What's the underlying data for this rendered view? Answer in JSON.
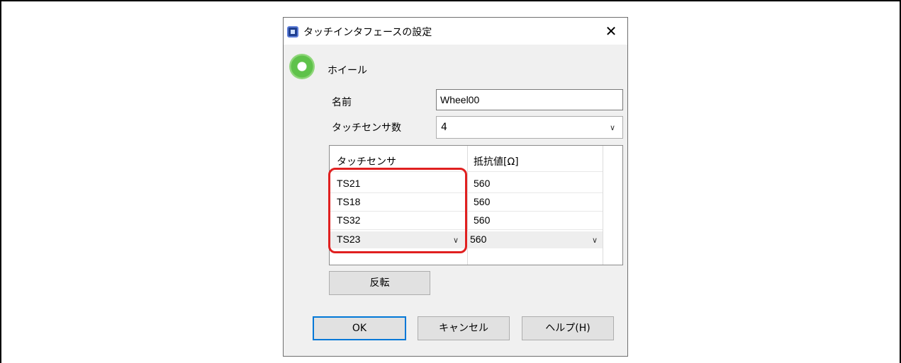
{
  "dialog": {
    "title": "タッチインタフェースの設定",
    "close_label": "✕",
    "section_title": "ホイール"
  },
  "form": {
    "name_label": "名前",
    "name_value": "Wheel00",
    "sensor_count_label": "タッチセンサ数",
    "sensor_count_value": "4"
  },
  "table": {
    "headers": [
      "タッチセンサ",
      "抵抗値[Ω]"
    ],
    "rows": [
      {
        "sensor": "TS21",
        "resistance": "560"
      },
      {
        "sensor": "TS18",
        "resistance": "560"
      },
      {
        "sensor": "TS32",
        "resistance": "560"
      },
      {
        "sensor": "TS23",
        "resistance": "560"
      }
    ],
    "selected_row": 3
  },
  "buttons": {
    "invert": "反転",
    "ok": "OK",
    "cancel": "キャンセル",
    "help": "ヘルプ(H)"
  },
  "icons": {
    "dropdown": "chevron-down-icon",
    "app": "app-icon",
    "wheel": "wheel-icon"
  },
  "colors": {
    "highlight": "#e02020",
    "ok_border": "#0078d7",
    "wheel_green": "#5fc24a"
  }
}
